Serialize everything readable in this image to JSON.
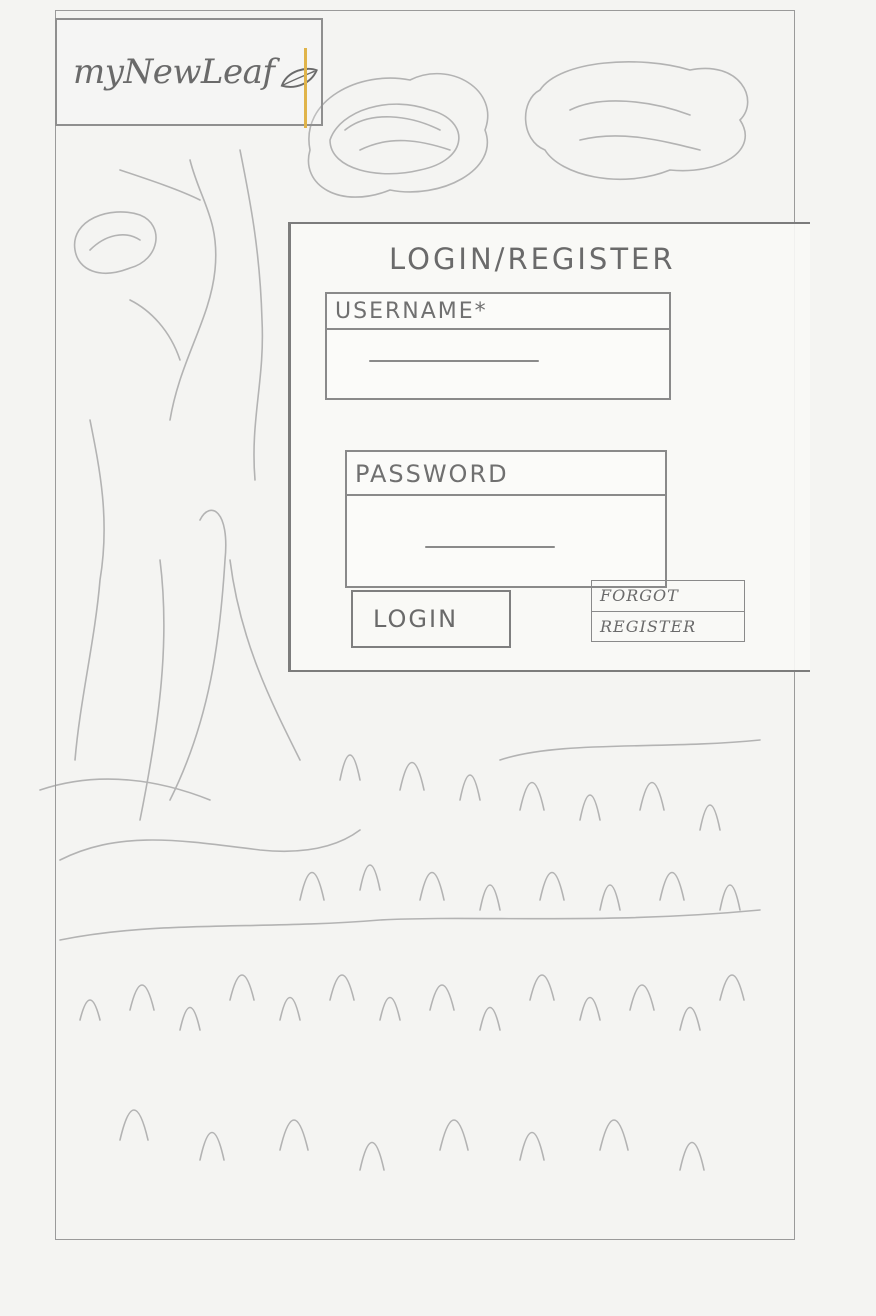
{
  "header": {
    "logo_text": "myNewLeaf"
  },
  "login_panel": {
    "title": "LOGIN/REGISTER",
    "username": {
      "label": "USERNAME*",
      "value": ""
    },
    "password": {
      "label": "PASSWORD",
      "value": ""
    },
    "login_button": "LOGIN",
    "forgot_link": "FORGOT",
    "register_link": "REGISTER"
  },
  "icons": {
    "logo_leaf": "leaf-icon",
    "background": "tree-and-grass-illustration"
  },
  "colors": {
    "paper": "#f4f4f2",
    "pencil": "#8a8a8a",
    "cursor_accent": "#e0b44a"
  }
}
